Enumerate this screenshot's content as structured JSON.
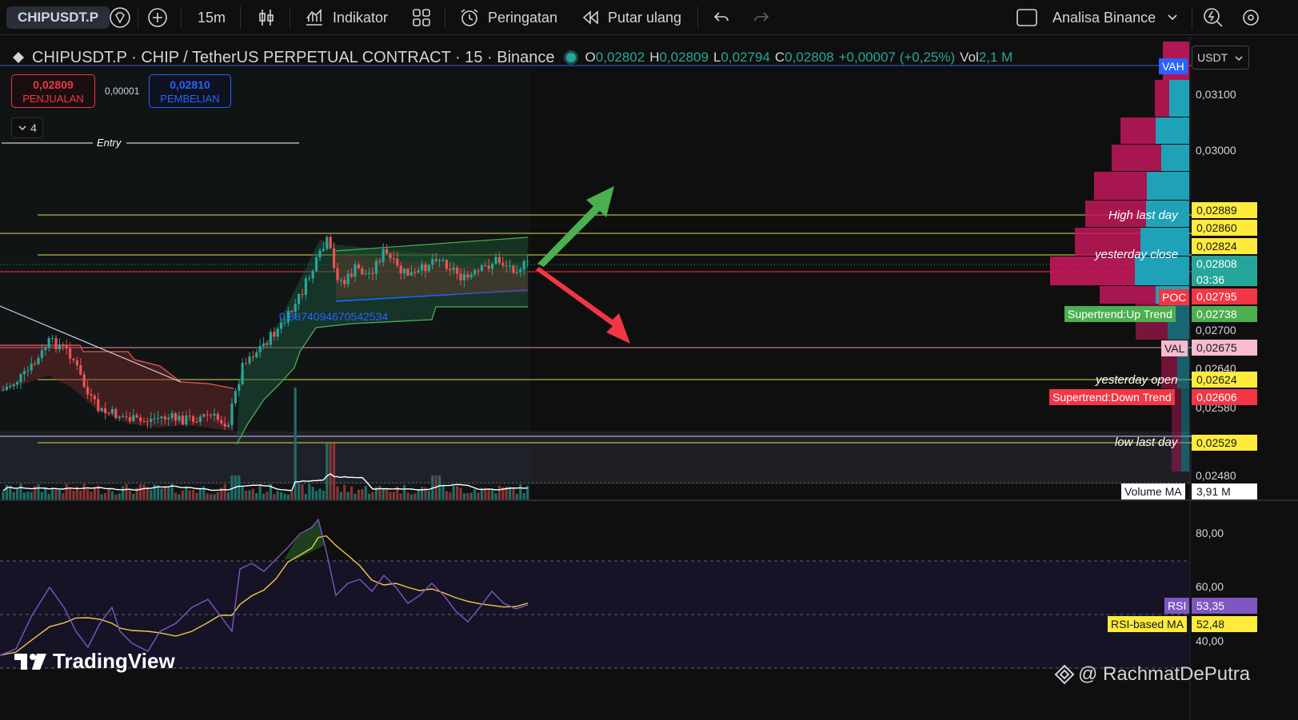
{
  "toolbar": {
    "symbol": "CHIPUSDT.P",
    "interval": "15m",
    "indicators_label": "Indikator",
    "alerts_label": "Peringatan",
    "replay_label": "Putar ulang",
    "layout_name": "Analisa Binance"
  },
  "legend": {
    "title": "CHIPUSDT.P · CHIP / TetherUS PERPETUAL CONTRACT · 15 · Binance",
    "open_label": "O",
    "open": "0,02802",
    "high_label": "H",
    "high": "0,02809",
    "low_label": "L",
    "low": "0,02794",
    "close_label": "C",
    "close": "0,02808",
    "change": "+0,00007 (+0,25%)",
    "vol_label": "Vol",
    "vol": "2,1 M"
  },
  "trade": {
    "sell_price": "0,02809",
    "sell_label": "PENJUALAN",
    "spread": "0,00001",
    "buy_price": "0,02810",
    "buy_label": "PEMBELIAN",
    "collapse_count": "4"
  },
  "annotations": {
    "entry": "Entry",
    "long_number": "0.8874094670542534",
    "high_last_day": "High last day",
    "yesterday_close": "yesterday close",
    "yesterday_open": "yesterday open",
    "low_last_day": "low last day"
  },
  "price_axis": {
    "currency": "USDT",
    "ticks": [
      "0,03100",
      "0,03000",
      "0,02700",
      "0,02640",
      "0,02580",
      "0,02480"
    ],
    "tags": {
      "vah_label": "VAH",
      "high_last_day": "0,02889",
      "p2860": "0,02860",
      "p2824": "0,02824",
      "last": "0,02808",
      "countdown": "03:36",
      "poc_label": "POC",
      "poc": "0,02795",
      "st_up_label": "Supertrend:Up Trend",
      "st_up": "0,02738",
      "val_label": "VAL",
      "val": "0,02675",
      "yesterday_open": "0,02624",
      "st_down_label": "Supertrend:Down Trend",
      "st_down": "0,02606",
      "low_last_day": "0,02529"
    }
  },
  "volume": {
    "label": "Volume MA",
    "value": "3,91 M"
  },
  "rsi": {
    "ticks": [
      "80,00",
      "60,00",
      "40,00"
    ],
    "rsi_label": "RSI",
    "rsi_value": "53,35",
    "ma_label": "RSI-based MA",
    "ma_value": "52,48"
  },
  "watermark": {
    "brand": "TradingView",
    "author": "@ RachmatDePutra"
  },
  "colors": {
    "up": "#26a69a",
    "down": "#ef5350",
    "yellow": "#ffeb3b",
    "rsi": "#7e57c2",
    "green_arrow": "#4caf50",
    "red_arrow": "#f23645"
  }
}
